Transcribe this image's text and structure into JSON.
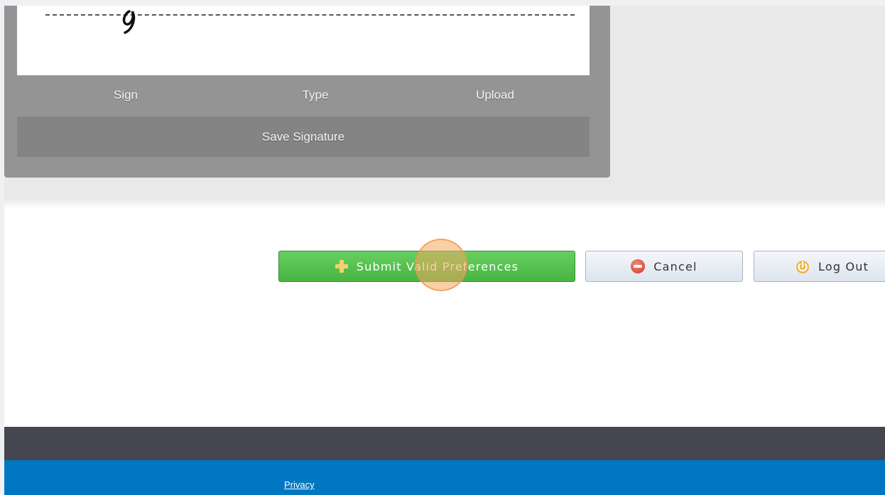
{
  "signature": {
    "tabs": [
      "Sign",
      "Type",
      "Upload"
    ],
    "save_label": "Save Signature"
  },
  "actions": {
    "submit_label": "Submit Valid Preferences",
    "cancel_label": "Cancel",
    "logout_label": "Log Out",
    "submit_icon": "plus-icon",
    "cancel_icon": "no-entry-icon",
    "logout_icon": "power-icon"
  },
  "footer": {
    "privacy_label": "Privacy"
  },
  "colors": {
    "submit_green": "#4cba45",
    "footer_dark": "#44474f",
    "footer_blue": "#0077c0",
    "panel_gray": "#949494"
  }
}
